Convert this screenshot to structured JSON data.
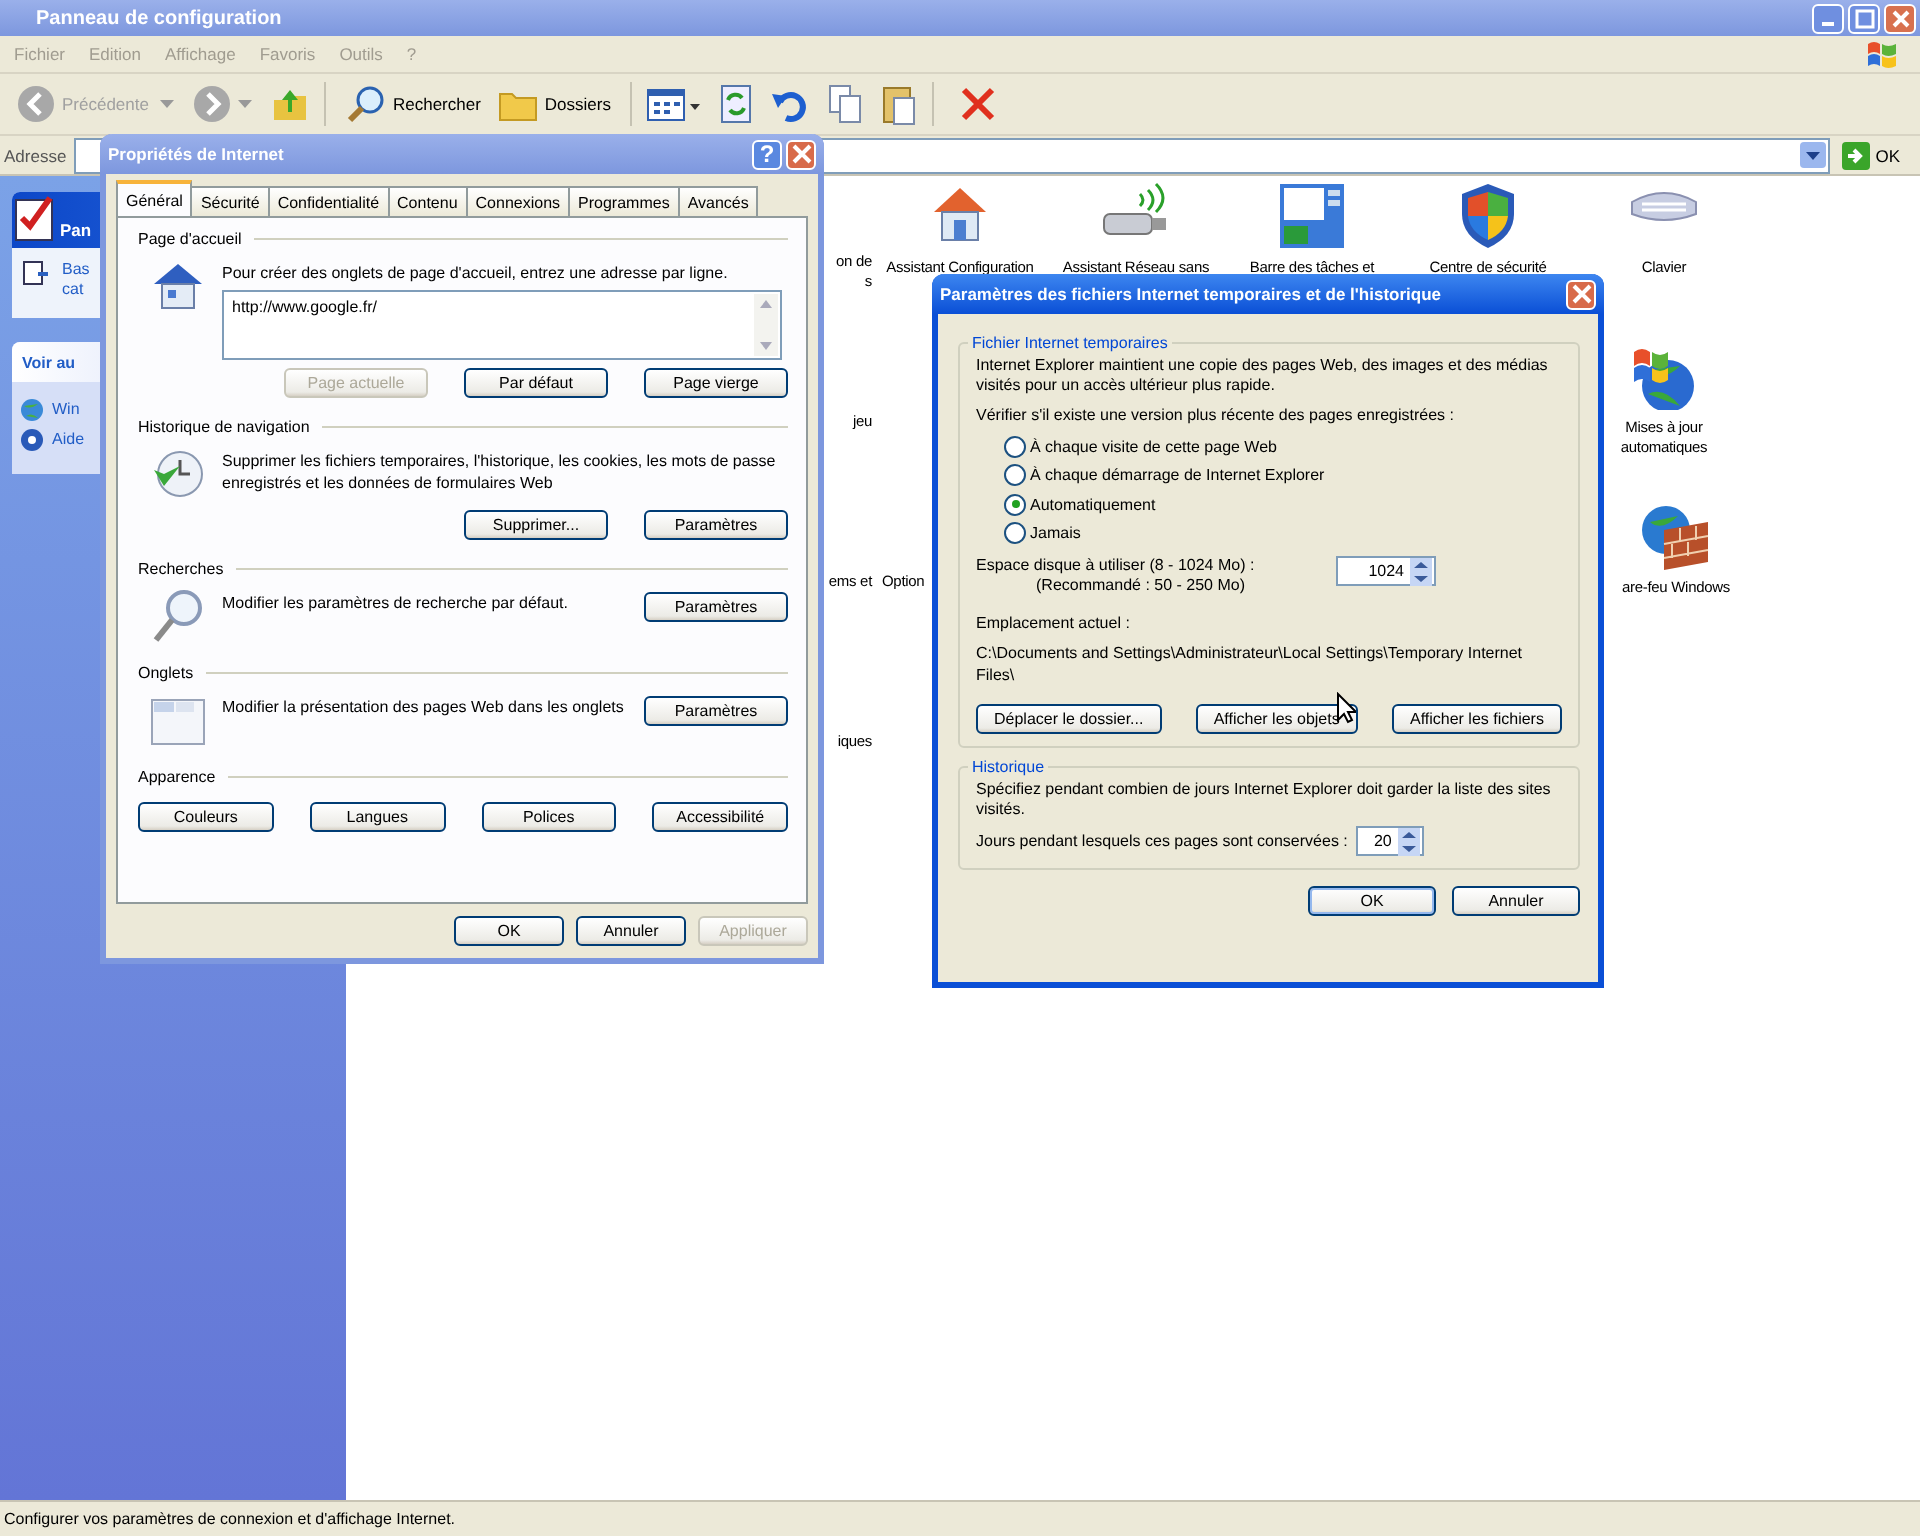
{
  "window": {
    "title": "Panneau de configuration"
  },
  "menu": [
    "Fichier",
    "Edition",
    "Affichage",
    "Favoris",
    "Outils",
    "?"
  ],
  "toolbar": {
    "back": {
      "label": "Précédente",
      "disabled": true
    },
    "search": "Rechercher",
    "folders": "Dossiers"
  },
  "address": {
    "label": "Adresse",
    "go": "OK"
  },
  "sidebar": {
    "header": "Pan",
    "links": [
      "Bas",
      "cat"
    ],
    "see_also": "Voir au",
    "items": [
      "Win",
      "Aide"
    ]
  },
  "items": [
    {
      "kind": "fragment",
      "lines": [
        "on de",
        "s"
      ]
    },
    {
      "kind": "icon",
      "lines": [
        "Assistant Configuration"
      ]
    },
    {
      "kind": "icon",
      "lines": [
        "Assistant Réseau sans"
      ]
    },
    {
      "kind": "icon",
      "lines": [
        "Barre des tâches et"
      ]
    },
    {
      "kind": "icon",
      "lines": [
        "Centre de sécurité"
      ]
    },
    {
      "kind": "icon",
      "lines": [
        "Clavier"
      ]
    },
    {
      "kind": "fragment",
      "lines": [
        "jeu"
      ]
    },
    {
      "kind": "icon",
      "lines": [
        "Mises à jour",
        "automatiques"
      ]
    },
    {
      "kind": "fragment",
      "lines": [
        "ems et"
      ]
    },
    {
      "kind": "fragment",
      "lines": [
        "Option"
      ]
    },
    {
      "kind": "icon",
      "lines": [
        "are-feu Windows"
      ]
    },
    {
      "kind": "fragment",
      "lines": [
        "iques"
      ]
    }
  ],
  "status_bar": "Configurer vos paramètres de connexion et d'affichage Internet.",
  "props_dialog": {
    "title": "Propriétés de Internet",
    "help": "?",
    "tabs": [
      {
        "label": "Général",
        "selected": true
      },
      {
        "label": "Sécurité",
        "selected": false
      },
      {
        "label": "Confidentialité",
        "selected": false
      },
      {
        "label": "Contenu",
        "selected": false
      },
      {
        "label": "Connexions",
        "selected": false
      },
      {
        "label": "Programmes",
        "selected": false
      },
      {
        "label": "Avancés",
        "selected": false
      }
    ],
    "sections": [
      {
        "kind": "stacked",
        "heading": "Page d'accueil",
        "text": "Pour créer des onglets de page d'accueil, entrez une adresse par ligne.",
        "value": "http://www.google.fr/",
        "buttons": [
          {
            "label": "Page actuelle",
            "disabled": true
          },
          {
            "label": "Par défaut",
            "disabled": false
          },
          {
            "label": "Page vierge",
            "disabled": false
          }
        ]
      },
      {
        "kind": "stacked",
        "heading": "Historique de navigation",
        "text": "Supprimer les fichiers temporaires, l'historique, les cookies, les mots de passe enregistrés et les données de formulaires Web",
        "buttons": [
          {
            "label": "Supprimer...",
            "disabled": false
          },
          {
            "label": "Paramètres",
            "disabled": false
          }
        ]
      },
      {
        "kind": "inline",
        "heading": "Recherches",
        "text": "Modifier les paramètres de recherche par défaut.",
        "buttons": [
          {
            "label": "Paramètres",
            "disabled": false
          }
        ]
      },
      {
        "kind": "inline",
        "heading": "Onglets",
        "text": "Modifier la présentation des pages Web dans les onglets",
        "buttons": [
          {
            "label": "Paramètres",
            "disabled": false
          }
        ]
      },
      {
        "kind": "buttons",
        "heading": "Apparence",
        "buttons": [
          {
            "label": "Couleurs",
            "disabled": false
          },
          {
            "label": "Langues",
            "disabled": false
          },
          {
            "label": "Polices",
            "disabled": false
          },
          {
            "label": "Accessibilité",
            "disabled": false
          }
        ]
      }
    ],
    "footer": [
      {
        "label": "OK",
        "disabled": false
      },
      {
        "label": "Annuler",
        "disabled": false
      },
      {
        "label": "Appliquer",
        "disabled": true
      }
    ]
  },
  "cache_dialog": {
    "title": "Paramètres des fichiers Internet temporaires et de l'historique",
    "temp": {
      "heading": "Fichier Internet temporaires",
      "intro": "Internet Explorer maintient une copie des pages Web, des images et des médias visités pour un accès ultérieur plus rapide.",
      "check_label": "Vérifier s'il existe une version plus récente des pages enregistrées :",
      "options": [
        {
          "label": "À chaque visite de cette page Web",
          "selected": false
        },
        {
          "label": "À chaque démarrage de Internet Explorer",
          "selected": false
        },
        {
          "label": "Automatiquement",
          "selected": true
        },
        {
          "label": "Jamais",
          "selected": false
        }
      ],
      "disk_label": "Espace disque à utiliser (8 - 1024 Mo) :",
      "disk_hint": "(Recommandé : 50 - 250 Mo)",
      "disk_value": "1024",
      "location_label": "Emplacement actuel :",
      "location": "C:\\Documents and Settings\\Administrateur\\Local Settings\\Temporary Internet Files\\",
      "buttons": [
        "Déplacer le dossier...",
        "Afficher les objets",
        "Afficher les fichiers"
      ]
    },
    "history": {
      "heading": "Historique",
      "text": "Spécifiez pendant combien de jours Internet Explorer doit garder la liste des sites visités.",
      "days_label": "Jours pendant lesquels ces pages sont conservées :",
      "days_value": "20"
    },
    "buttons": [
      "OK",
      "Annuler"
    ]
  }
}
